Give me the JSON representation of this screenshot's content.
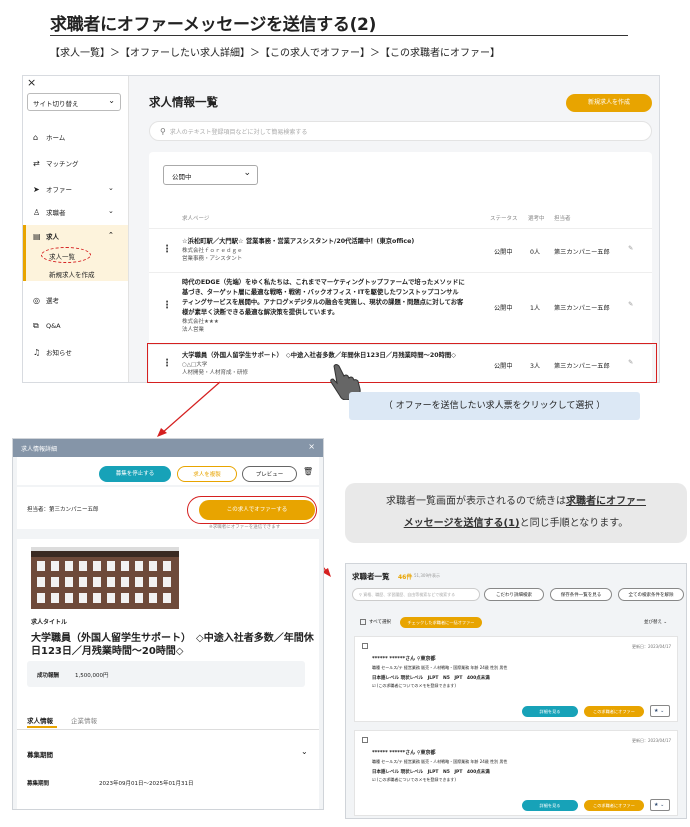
{
  "page": {
    "title": "求職者にオファーメッセージを送信する(2)",
    "breadcrumb": "【求人一覧】＞【オファーしたい求人詳細】＞【この求人でオファー】＞【この求職者にオファー】"
  },
  "joblist": {
    "close": "×",
    "site_switch": "サイト切り替え",
    "nav": [
      {
        "label": "ホーム",
        "icon": "home-icon"
      },
      {
        "label": "マッチング",
        "icon": "handshake-icon"
      },
      {
        "label": "オファー",
        "icon": "send-icon"
      },
      {
        "label": "求職者",
        "icon": "people-icon"
      },
      {
        "label": "求人",
        "icon": "document-icon"
      },
      {
        "label": "求人一覧",
        "icon": ""
      },
      {
        "label": "新規求人を作成",
        "icon": ""
      },
      {
        "label": "選考",
        "icon": "check-circle-icon"
      },
      {
        "label": "Q&A",
        "icon": "qa-icon"
      },
      {
        "label": "お知らせ",
        "icon": "bell-icon"
      }
    ],
    "heading": "求人情報一覧",
    "new_button": "新規求人を作成",
    "search_placeholder": "求人のテキスト登録項目などに対して簡易検索する",
    "status_filter": "公開中",
    "columns": [
      "求人ページ",
      "ステータス",
      "選考中",
      "担当者"
    ],
    "rows": [
      {
        "title": "☆浜松町駅／大門駅☆ 営業事務・営業アスシスタント/20代活躍中！(東京office)",
        "sub1": "株式会社ｆｏｒｅｄｇｅ",
        "sub2": "営業事務・アシスタント",
        "status": "公開中",
        "count": "0人",
        "owner": "第三カンパニー五郎"
      },
      {
        "title1": "時代のEDGE（先端）をゆく私たちは、これまでマーケティングトップファームで培ったメソッドに",
        "title2": "基づき、ターゲット層に最適な戦略・戦術・バックオフィス・ITを駆使したワンストップコンサル",
        "title3": "ティングサービスを展開中。アナログ×デジタルの融合を実施し、現状の課題・問題点に対してお客",
        "title4": "様が素早く決断できる最適な解決策を提供しています。",
        "sub1": "株式会社★★★",
        "sub2": "法人営業",
        "status": "公開中",
        "count": "1人",
        "owner": "第三カンパニー五郎"
      },
      {
        "title": "大学職員（外国人留学生サポート）　◇中途入社者多数／年間休日123日／月残業時間～20時間◇",
        "sub1": "○△□大学",
        "sub2": "人材開発・人材育成・研修",
        "status": "公開中",
        "count": "3人",
        "owner": "第三カンパニー五郎"
      }
    ]
  },
  "tip": "（ オファーを送信したい求人票をクリックして選択 ）",
  "detail": {
    "header": "求人情報詳細",
    "stop_button": "募集を停止する",
    "edit_button": "求人を複製",
    "preview_button": "プレビュー",
    "owner": "担当者：第三カンパニー五郎",
    "offer_button": "この求人でオファーする",
    "offer_hint": "※求職者にオファーを送信できます",
    "section_label": "求人タイトル",
    "job_title_1": "大学職員（外国人留学生サポート）　◇中途入社者多数／年間休",
    "job_title_2": "日123日／月残業時間～20時間◇",
    "reward_label": "成功報酬",
    "reward_value": "1,500,000円",
    "tab_job": "求人情報",
    "tab_company": "企業情報",
    "period_section": "募集期間",
    "period_label": "募集期間",
    "period_value": "2023年09月01日～2025年01月31日"
  },
  "note": {
    "text1": "求職者一覧画面が表示されるので続きは",
    "text_bold1": "求職者にオファー",
    "text_bold2": "メッセージを送信する(1)",
    "text2": "と同じ手順となります。"
  },
  "seekers": {
    "heading": "求職者一覧",
    "count": "46件",
    "count_sub": "51,309件表示",
    "search_placeholder": "資格、職歴、学習履歴、自由等検索などで検索する",
    "btn1": "こだわり詳細検索",
    "btn2": "保存条件一覧を見る",
    "btn3": "全ての検索条件を解除",
    "select_all": "すべて選択",
    "bulk_offer": "チェックした求職者に一括オファー",
    "sort": "並び替え",
    "cards": [
      {
        "date": "更新日：2023/04/17",
        "name": "****** ******さん",
        "location": "東京都",
        "tags": "職種 セールス/テ 経営業務 販売・人材戦略・国際業務 年齢 24歳 性別 男性",
        "lang": "日本語レベル 現状レベル　JLPT　N5　JPT　400点未満",
        "memo": "(この求職者についてのメモを登録できます)",
        "detail_btn": "詳細を見る",
        "offer_btn": "この求職者にオファー"
      },
      {
        "date": "更新日：2023/04/17",
        "name": "****** ******さん",
        "location": "東京都",
        "tags": "職種 セールス/テ 経営業務 販売・人材戦略・国際業務 年齢 24歳 性別 男性",
        "lang": "日本語レベル 現状レベル　JLPT　N5　JPT　400点未満",
        "memo": "(この求職者についてのメモを登録できます)",
        "detail_btn": "詳細を見る",
        "offer_btn": "この求職者にオファー"
      }
    ]
  },
  "colors": {
    "accent": "#e8a400",
    "teal": "#17a2b8",
    "red": "#d52020",
    "navy": "#2f4a70"
  }
}
